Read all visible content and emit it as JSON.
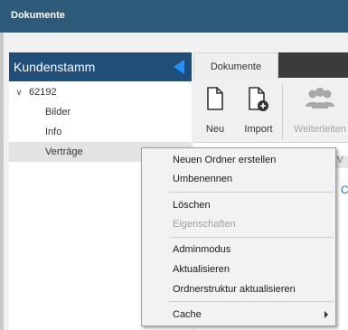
{
  "window": {
    "title": "Dokumente"
  },
  "panel": {
    "title": "Kundenstamm"
  },
  "tree": {
    "root": "62192",
    "children": [
      "Bilder",
      "Info",
      "Verträge"
    ],
    "selected": "Verträge"
  },
  "tabs": {
    "active": "Dokumente"
  },
  "ribbon": {
    "buttons": [
      {
        "label": "Neu",
        "icon": "new-document-icon"
      },
      {
        "label": "Import",
        "icon": "import-document-icon"
      },
      {
        "label": "Weiterleiten",
        "icon": "forward-users-icon",
        "disabled": true
      }
    ]
  },
  "content": {
    "column_fragment": "V",
    "link_fragment": "C"
  },
  "context_menu": {
    "items": [
      {
        "label": "Neuen Ordner erstellen"
      },
      {
        "label": "Umbenennen"
      },
      {
        "label": "Löschen"
      },
      {
        "label": "Eigenschaften",
        "disabled": true
      },
      {
        "label": "Adminmodus"
      },
      {
        "label": "Aktualisieren"
      },
      {
        "label": "Ordnerstruktur aktualisieren"
      },
      {
        "label": "Cache",
        "submenu": true
      }
    ]
  },
  "colors": {
    "titlebar": "#2e5a7a",
    "panel_header": "#1f4e79",
    "accent": "#1e90ff",
    "tabstrip": "#3b3b3b"
  }
}
